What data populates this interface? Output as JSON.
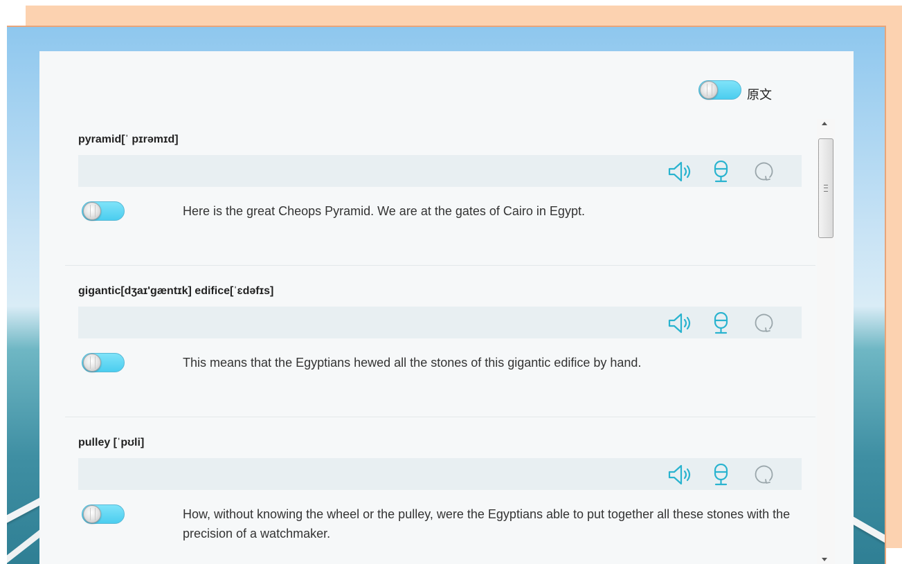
{
  "header": {
    "toggle_label": "原文"
  },
  "items": [
    {
      "word": "pyramid[ˈ pɪrəmɪd]",
      "sentence": "Here is the great Cheops Pyramid. We are at the gates of Cairo in Egypt."
    },
    {
      "word": "gigantic[dʒaɪ'gæntɪk] edifice[ˈɛdəfɪs]",
      "sentence": "This means that the Egyptians hewed all the stones of this gigantic edifice by hand."
    },
    {
      "word": "pulley [ˈpʊli]",
      "sentence": "How, without knowing the wheel or the pulley, were the Egyptians able to put together all these stones with the precision of a watchmaker."
    }
  ],
  "icons": {
    "play": "speaker-icon",
    "record": "microphone-icon",
    "replay": "replay-icon"
  },
  "colors": {
    "accent": "#29b3cf",
    "toggle": "#4bcdef",
    "panel": "#f6f8f9",
    "bar": "#e8eff2",
    "frame": "#fcd2b0"
  }
}
